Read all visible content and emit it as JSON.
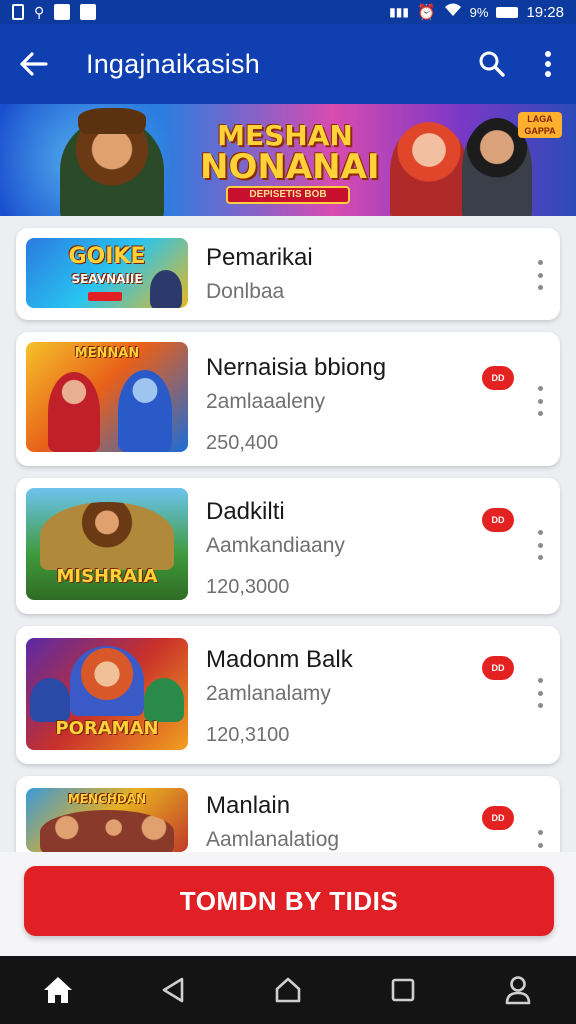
{
  "status_bar": {
    "time": "19:28",
    "battery": "9%"
  },
  "app_bar": {
    "title": "Ingajnaikasish"
  },
  "banner": {
    "title_line1": "MESHAN",
    "title_line2": "NONANAI",
    "ribbon": "DEPISETIS BOB",
    "tag": "LAGA GAPPA"
  },
  "items": [
    {
      "name": "Pemarikai",
      "subtitle": "Donlbaa",
      "count": "",
      "thumb_title": "GOIKE",
      "thumb_sub": "SEAVNAIIE",
      "has_badge": false,
      "badge_text": ""
    },
    {
      "name": "Nernaisia bbiong",
      "subtitle": "2amlaaaleny",
      "count": "250,400",
      "thumb_title": "MENNAN",
      "thumb_sub": "",
      "has_badge": true,
      "badge_text": "DD"
    },
    {
      "name": "Dadkilti",
      "subtitle": "Aamkandiaany",
      "count": "120,3000",
      "thumb_title": "MISHRAIA",
      "thumb_sub": "",
      "has_badge": true,
      "badge_text": "DD"
    },
    {
      "name": "Madonm Balk",
      "subtitle": "2amlanalamy",
      "count": "120,3100",
      "thumb_title": "PORAMAN",
      "thumb_sub": "",
      "has_badge": true,
      "badge_text": "DD"
    },
    {
      "name": "Manlain",
      "subtitle": "Aamlanalatiog",
      "count": "",
      "thumb_title": "MENCHDAN",
      "thumb_sub": "",
      "has_badge": true,
      "badge_text": "DD"
    }
  ],
  "cta": {
    "label": "TOMDN BY TIDIS"
  },
  "nav": [
    "home-icon",
    "back-triangle-icon",
    "home-outline-icon",
    "recents-square-icon",
    "profile-icon"
  ],
  "colors": {
    "app_bar": "#0f3fb0",
    "cta": "#e02024",
    "badge": "#e52222",
    "nav_bar": "#141414"
  }
}
